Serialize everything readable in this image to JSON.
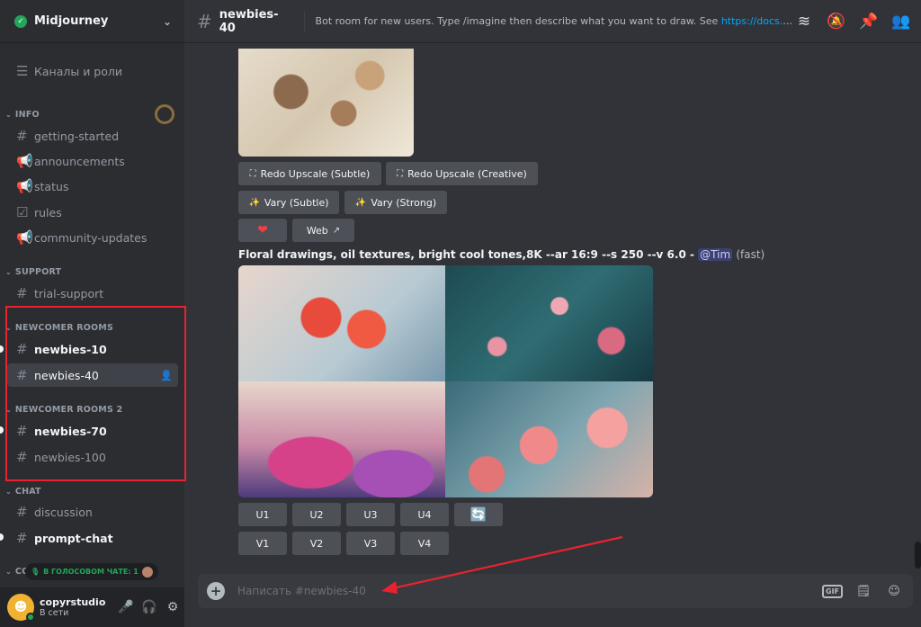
{
  "server": {
    "name": "Midjourney"
  },
  "sidebar": {
    "top_item": {
      "label": "Каналы и роли"
    },
    "categories": [
      {
        "name": "INFO"
      },
      {
        "name": "SUPPORT"
      },
      {
        "name": "NEWCOMER ROOMS"
      },
      {
        "name": "NEWCOMER ROOMS 2"
      },
      {
        "name": "CHAT"
      },
      {
        "name": "CO"
      }
    ],
    "channels": {
      "getting_started": "getting-started",
      "announcements": "announcements",
      "status": "status",
      "rules": "rules",
      "community_updates": "community-updates",
      "trial_support": "trial-support",
      "newbies_10": "newbies-10",
      "newbies_40": "newbies-40",
      "newbies_70": "newbies-70",
      "newbies_100": "newbies-100",
      "discussion": "discussion",
      "prompt_chat": "prompt-chat"
    }
  },
  "voice_pill": {
    "label": "В ГОЛОСОВОМ ЧАТЕ: 1"
  },
  "user": {
    "name": "copyrstudio",
    "status": "В сети"
  },
  "channel_header": {
    "name": "newbies-40",
    "topic": "Bot room for new users. Type /imagine then describe what you want to draw. See ",
    "link": "https://docs.midjourney.c..."
  },
  "message1": {
    "buttons": {
      "redo_subtle": "Redo Upscale (Subtle)",
      "redo_creative": "Redo Upscale (Creative)",
      "vary_subtle": "Vary (Subtle)",
      "vary_strong": "Vary (Strong)",
      "web": "Web"
    }
  },
  "message2": {
    "prompt": "Floral drawings, oil textures, bright cool tones,8K --ar 16:9 --s 250 --v 6.0 - ",
    "mention": "@Tim",
    "speed": "(fast)",
    "upscale_buttons": [
      "U1",
      "U2",
      "U3",
      "U4"
    ],
    "variation_buttons": [
      "V1",
      "V2",
      "V3",
      "V4"
    ]
  },
  "composer": {
    "placeholder": "Написать #newbies-40"
  },
  "colors": {
    "annotation_red": "#e8232f",
    "online": "#23a55a",
    "link": "#00a8fc"
  }
}
